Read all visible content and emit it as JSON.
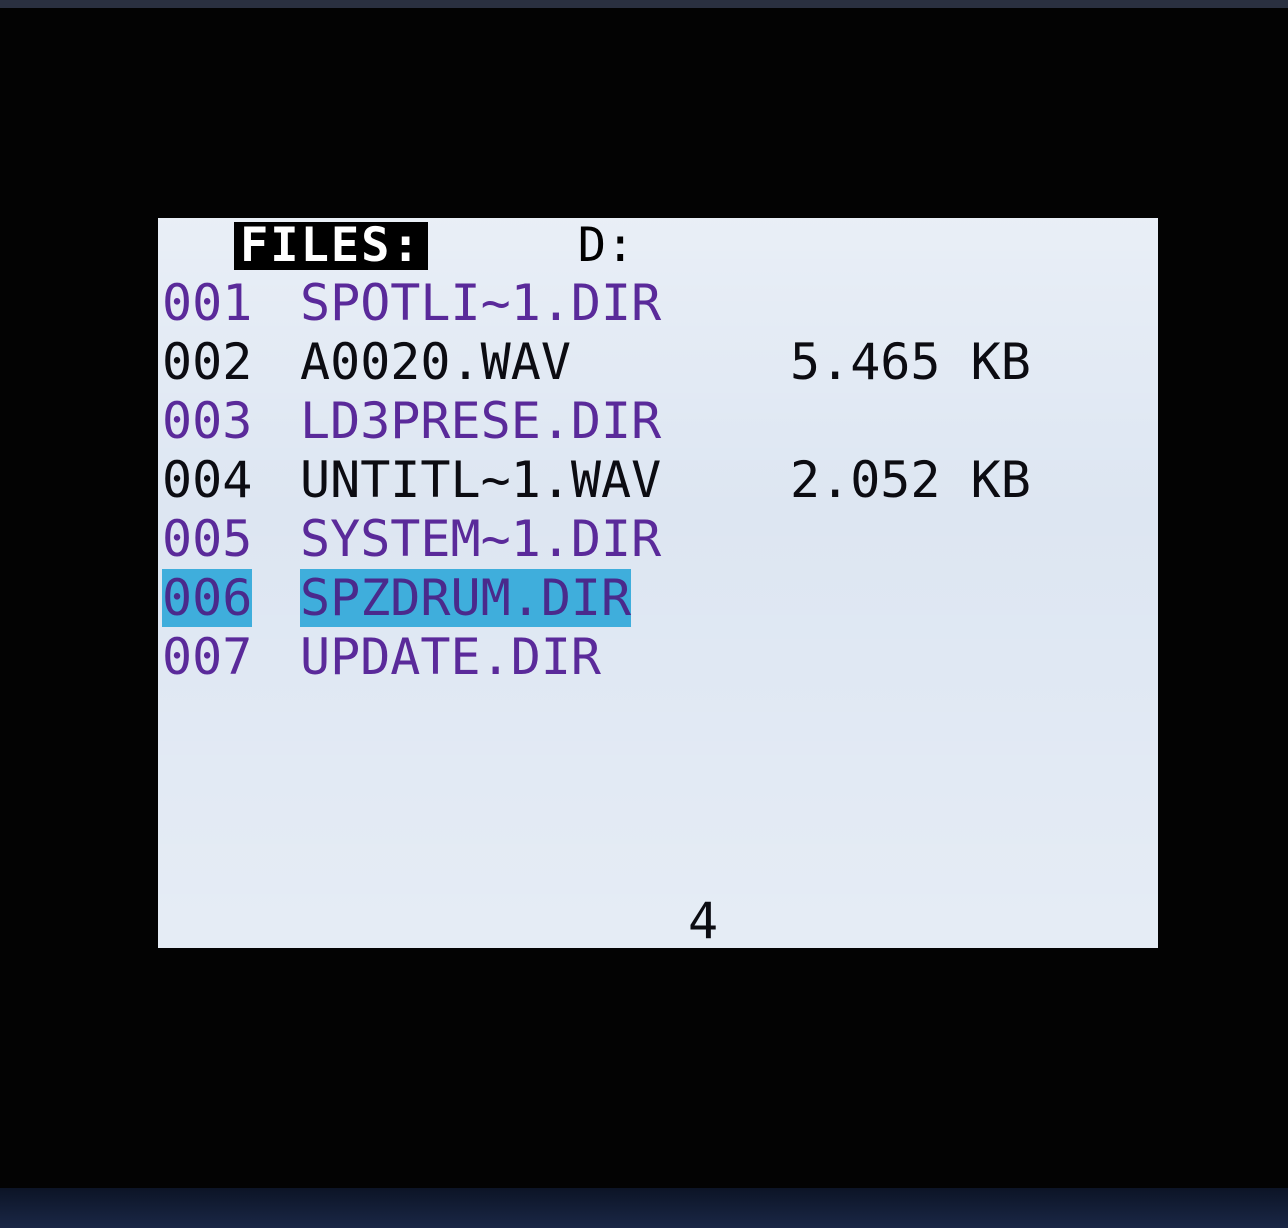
{
  "header": {
    "title": "FILES:",
    "drive": "D:"
  },
  "files": [
    {
      "number": "001",
      "name": "SPOTLI~1.DIR",
      "size": "",
      "type": "dir"
    },
    {
      "number": "002",
      "name": "A0020.WAV",
      "size": "5.465 KB",
      "type": "file"
    },
    {
      "number": "003",
      "name": "LD3PRESE.DIR",
      "size": "",
      "type": "dir"
    },
    {
      "number": "004",
      "name": "UNTITL~1.WAV",
      "size": "2.052 KB",
      "type": "file"
    },
    {
      "number": "005",
      "name": "SYSTEM~1.DIR",
      "size": "",
      "type": "dir"
    },
    {
      "number": "006",
      "name": "SPZDRUM.DIR",
      "size": "",
      "type": "dir",
      "selected": true
    },
    {
      "number": "007",
      "name": "UPDATE.DIR",
      "size": "",
      "type": "dir"
    }
  ],
  "footer": {
    "page_number": "4"
  },
  "colors": {
    "screen_background": "#dde6f2",
    "directory_text": "#5a2a9a",
    "file_text": "#0c0c12",
    "selection_highlight": "#3faedc"
  }
}
